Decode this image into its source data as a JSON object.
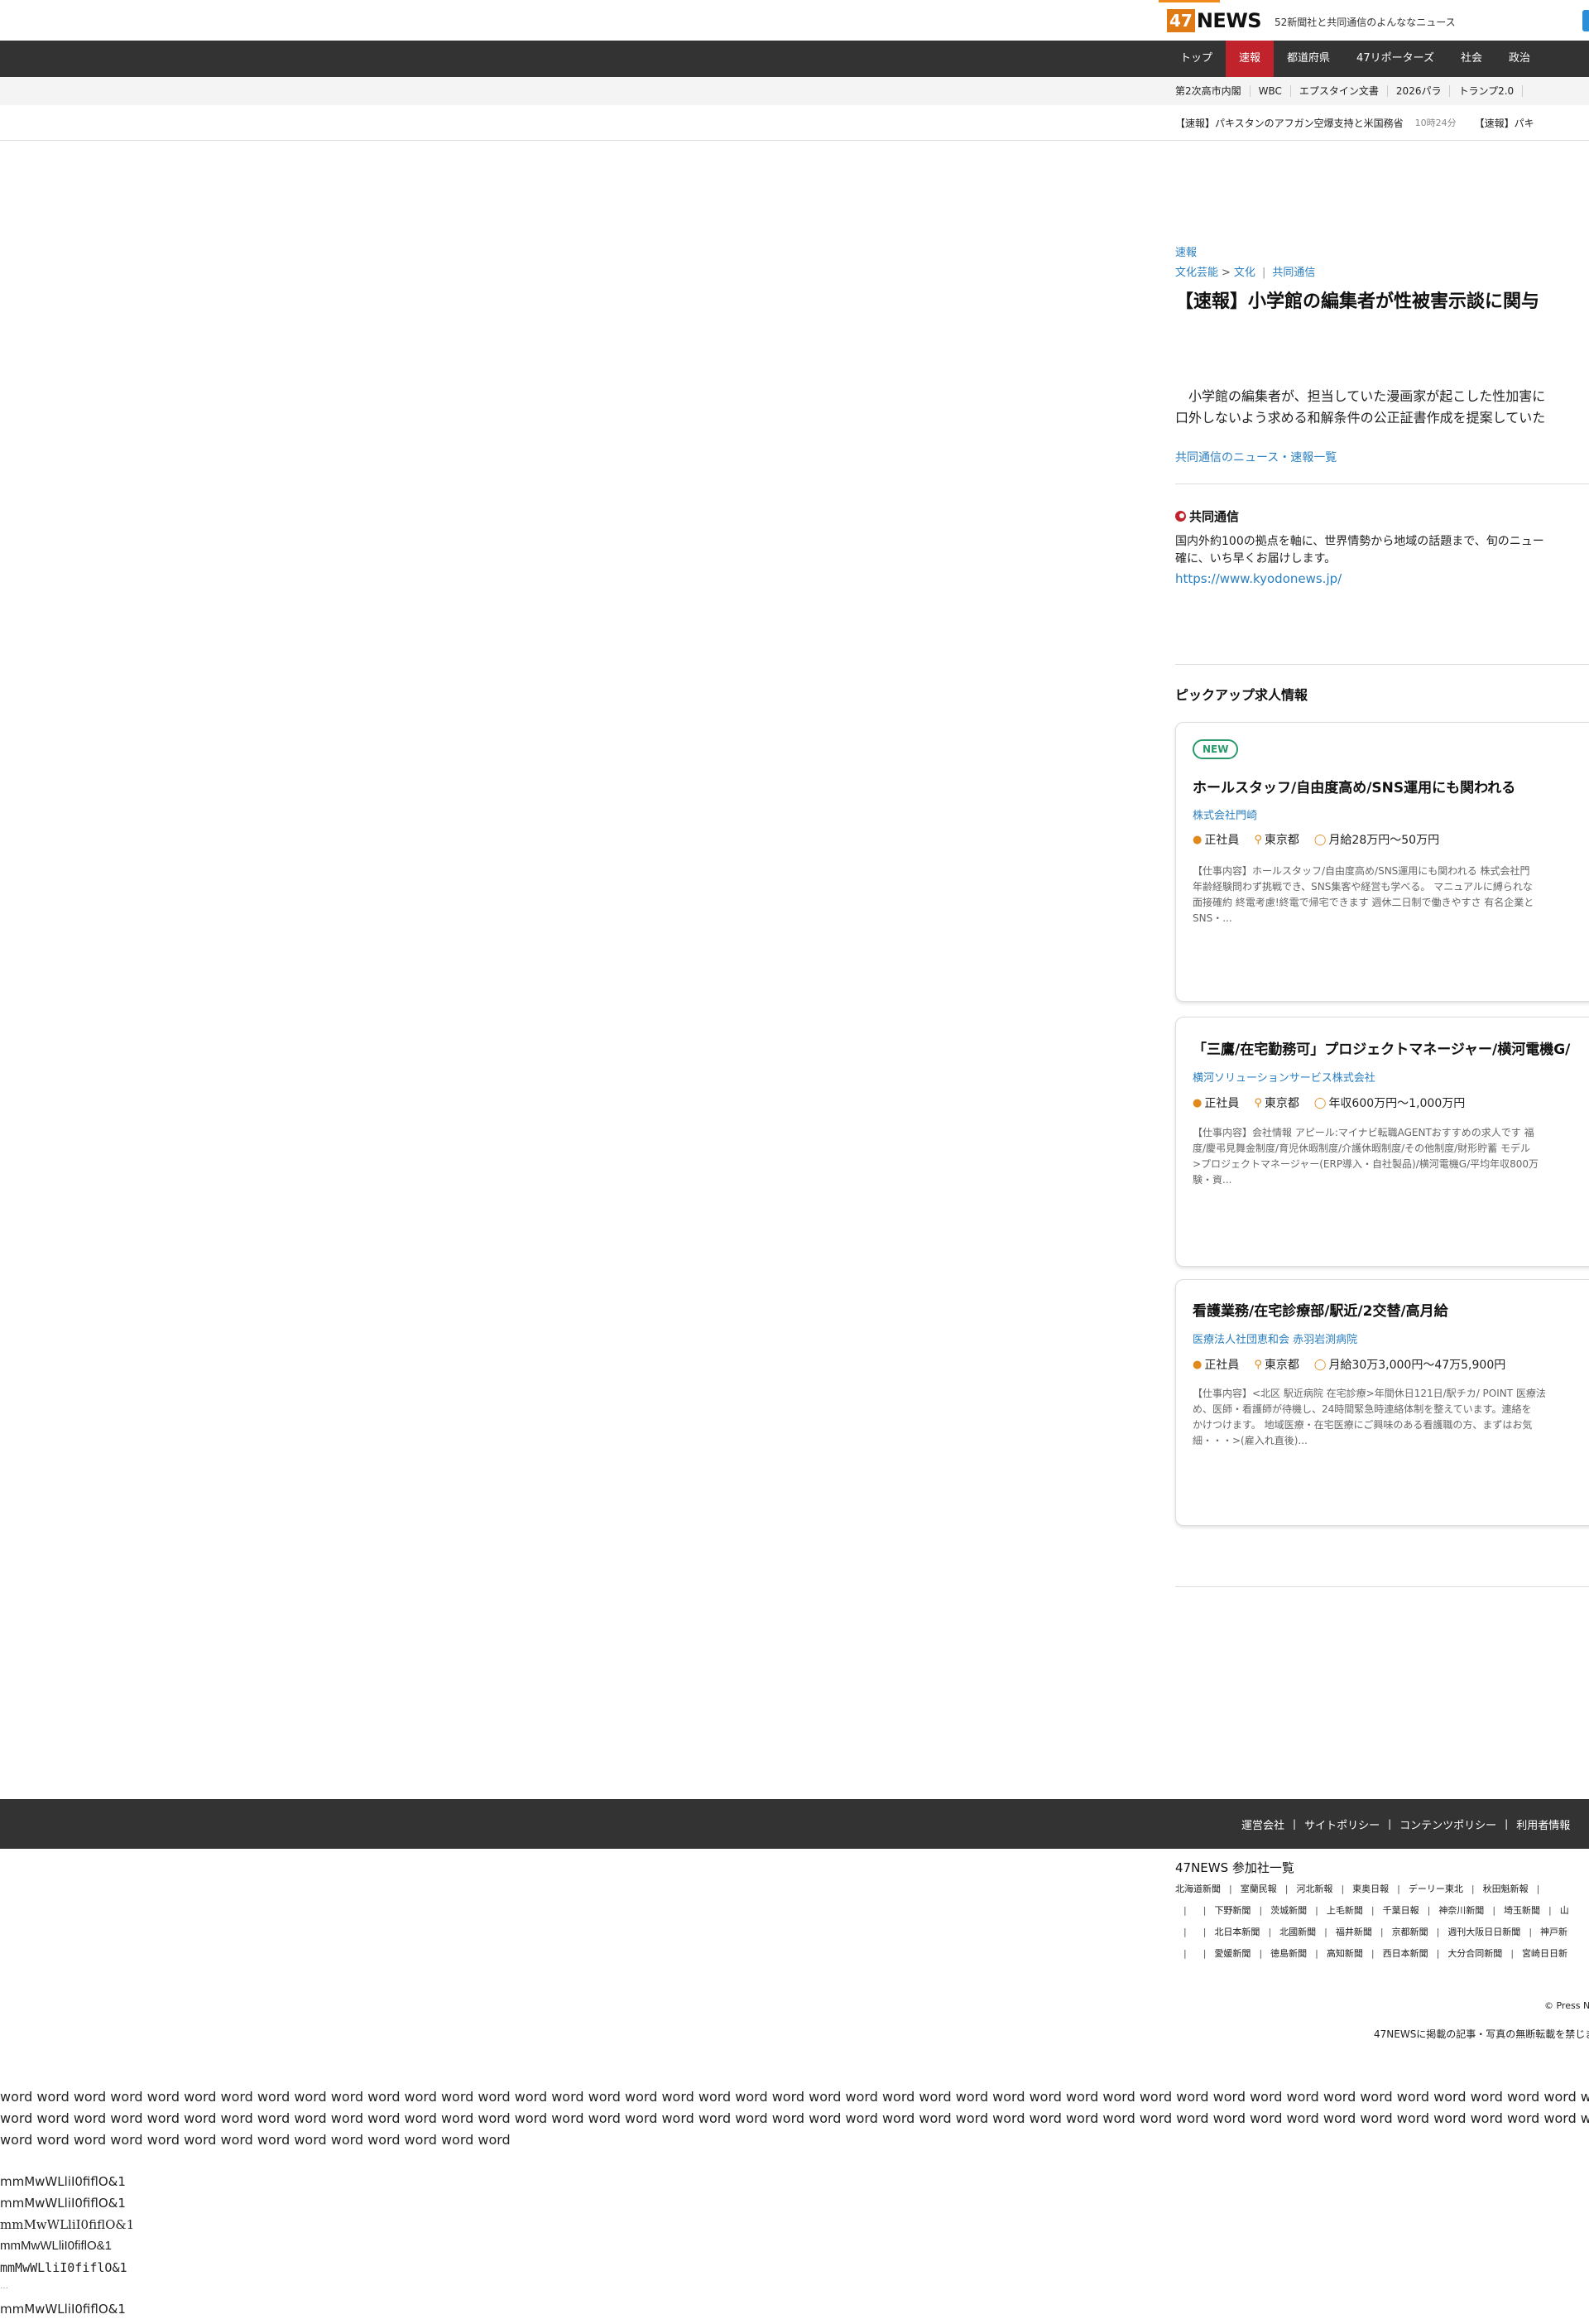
{
  "header": {
    "logo_number": "47",
    "logo_text": "NEWS",
    "tagline": "52新聞社と共同通信のよんななニュース"
  },
  "nav": {
    "items": [
      {
        "label": "トップ",
        "active": false
      },
      {
        "label": "速報",
        "active": true
      },
      {
        "label": "都道府県",
        "active": false
      },
      {
        "label": "47リポーターズ",
        "active": false
      },
      {
        "label": "社会",
        "active": false
      },
      {
        "label": "政治",
        "active": false
      }
    ]
  },
  "topics": [
    "第2次高市内閣",
    "WBC",
    "エプスタイン文書",
    "2026パラ",
    "トランプ2.0"
  ],
  "ticker": {
    "items": [
      {
        "text": "【速報】パキスタンのアフガン空爆支持と米国務省",
        "time": "10時24分"
      },
      {
        "text": "【速報】パキ",
        "time": ""
      }
    ]
  },
  "article": {
    "category": "速報",
    "breadcrumb": [
      "文化芸能",
      "文化"
    ],
    "breadcrumb_sep": ">",
    "source": "共同通信",
    "headline": "【速報】小学館の編集者が性被害示談に関与",
    "body_line1": "　小学館の編集者が、担当していた漫画家が起こした性加害に",
    "body_line2": "口外しないよう求める和解条件の公正証書作成を提案していた",
    "more_link": "共同通信のニュース・速報一覧"
  },
  "kyodo": {
    "name": "共同通信",
    "desc_line1": "国内外約100の拠点を軸に、世界情勢から地域の話題まで、旬のニュー",
    "desc_line2": "確に、いち早くお届けします。",
    "url": "https://www.kyodonews.jp/"
  },
  "pickup": {
    "title": "ピックアップ求人情報",
    "jobs": [
      {
        "badge": "NEW",
        "title": "ホールスタッフ/自由度高め/SNS運用にも関われる",
        "company": "株式会社門崎",
        "type": "正社員",
        "location": "東京都",
        "salary": "月給28万円〜50万円",
        "desc": "【仕事内容】ホールスタッフ/自由度高め/SNS運用にも関われる 株式会社門\n年齢経験問わず挑戦でき、SNS集客や経営も学べる。 マニュアルに縛られな\n面接確約 終電考慮!終電で帰宅できます 週休二日制で働きやすさ 有名企業と\nSNS・..."
      },
      {
        "badge": "",
        "title": "「三鷹/在宅勤務可」プロジェクトマネージャー/横河電機G/",
        "company": "横河ソリューションサービス株式会社",
        "type": "正社員",
        "location": "東京都",
        "salary": "年収600万円〜1,000万円",
        "desc": "【仕事内容】会社情報 アピール:マイナビ転職AGENTおすすめの求人です 福\n度/慶弔見舞金制度/育児休暇制度/介護休暇制度/その他制度/財形貯蓄 モデル\n>プロジェクトマネージャー(ERP導入・自社製品)/横河電機G/平均年収800万\n験・資..."
      },
      {
        "badge": "",
        "title": "看護業務/在宅診療部/駅近/2交替/高月給",
        "company": "医療法人社団恵和会 赤羽岩渕病院",
        "type": "正社員",
        "location": "東京都",
        "salary": "月給30万3,000円〜47万5,900円",
        "desc": "【仕事内容】<北区 駅近病院 在宅診療>年間休日121日/駅チカ/ POINT 医療法\nめ、医師・看護師が待機し、24時間緊急時連絡体制を整えています。連絡を\nかけつけます。 地域医療・在宅医療にご興味のある看護職の方、まずはお気\n細・・・>(雇入れ直後)..."
      }
    ]
  },
  "footer": {
    "links": [
      "運営会社",
      "サイトポリシー",
      "コンテンツポリシー",
      "利用者情報"
    ],
    "papers_title": "47NEWS 参加社一覧",
    "paper_rows": [
      [
        "北海道新聞",
        "室蘭民報",
        "河北新報",
        "東奥日報",
        "デーリー東北",
        "秋田魁新報",
        ""
      ],
      [
        "",
        "下野新聞",
        "茨城新聞",
        "上毛新聞",
        "千葉日報",
        "神奈川新聞",
        "埼玉新聞",
        "山"
      ],
      [
        "",
        "北日本新聞",
        "北國新聞",
        "福井新聞",
        "京都新聞",
        "週刊大阪日日新聞",
        "神戸新"
      ],
      [
        "",
        "愛媛新聞",
        "徳島新聞",
        "高知新聞",
        "西日本新聞",
        "大分合同新聞",
        "宮崎日日新"
      ]
    ],
    "notice": "47NEWSに掲載の記事・写真の無断転載を禁じま",
    "copyright": "© Press N"
  },
  "test_text": {
    "words_line1": "word word word word word word word word word word word word word word word word word word word word word word word word word word word word word word word word word word word word word word word word word word word word word word word word word word wor",
    "words_line2": "word word word word word word word word word word word word word word word word word word word word word word word word word word word word word word word word word word word word word word word word word word word word word word word word word word wor",
    "words_line3": "word word word word word word word word word word word word word word",
    "glyphs": [
      "mmMwWLliI0fiflO&1",
      "mmMwWLliI0fiflO&1",
      "mmMwWLliI0fiflO&1",
      "mmMwWLliI0fiflO&1",
      "mmMwWLliI0fiflO&1",
      "mmMwWLliI0fiflO&1"
    ],
    "ellipsis": "…"
  },
  "colors": {
    "accent_red": "#c0232b",
    "nav_bg": "#333333",
    "link_blue": "#2a7fc0",
    "icon_orange": "#e0891c",
    "badge_green": "#2a9a6a"
  }
}
